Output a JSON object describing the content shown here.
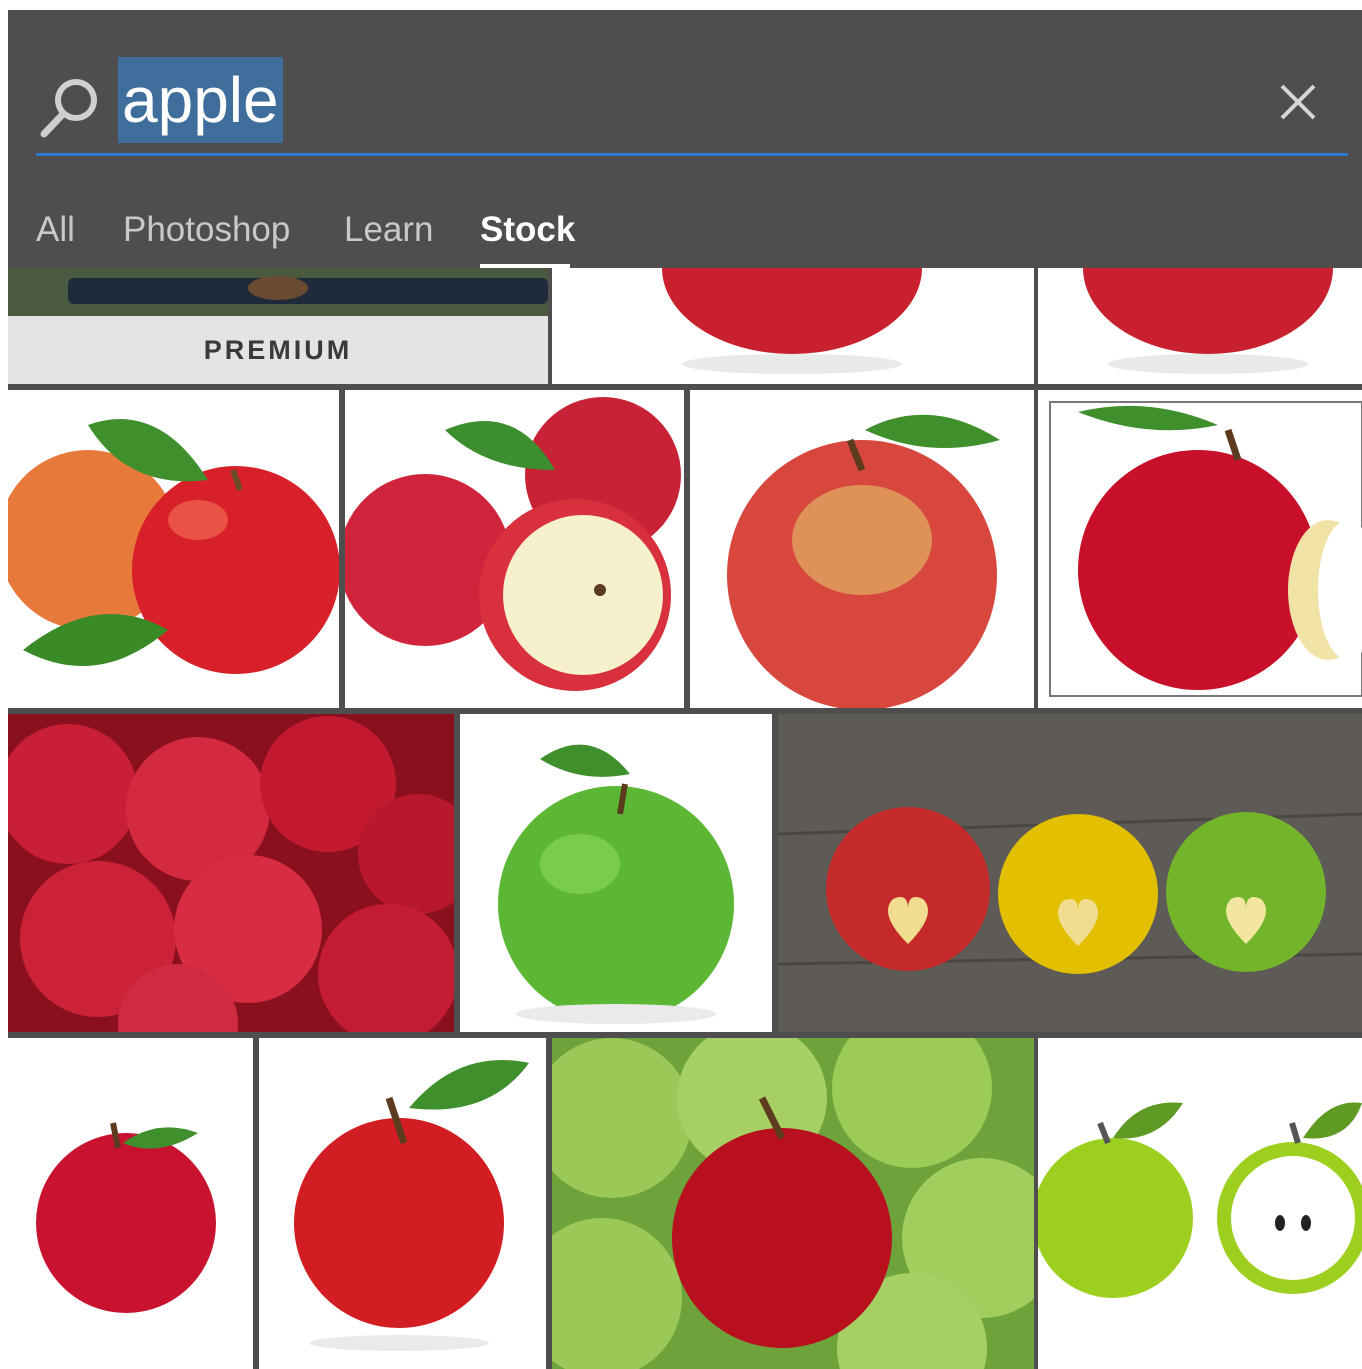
{
  "search": {
    "query": "apple",
    "clear_icon": "close-icon",
    "search_icon": "search-icon"
  },
  "tabs": [
    {
      "label": "All",
      "active": false
    },
    {
      "label": "Photoshop",
      "active": false
    },
    {
      "label": "Learn",
      "active": false
    },
    {
      "label": "Stock",
      "active": true
    }
  ],
  "results": {
    "premium_badge": "PREMIUM",
    "items": [
      {
        "subject": "premium-photo-partial"
      },
      {
        "subject": "red-apple-partial"
      },
      {
        "subject": "red-apple-partial"
      },
      {
        "subject": "two-red-apples-with-leaves"
      },
      {
        "subject": "red-apples-with-halved-apple"
      },
      {
        "subject": "red-green-apple-with-leaf"
      },
      {
        "subject": "bitten-red-apple"
      },
      {
        "subject": "pile-of-red-apples"
      },
      {
        "subject": "green-apple-with-leaf"
      },
      {
        "subject": "apples-with-heart-on-wood"
      },
      {
        "subject": "red-apple-with-leaf"
      },
      {
        "subject": "red-apple-with-green-leaf"
      },
      {
        "subject": "red-apple-among-green-apples"
      },
      {
        "subject": "green-apple-illustration"
      }
    ]
  },
  "colors": {
    "accent": "#2f7bd2",
    "panel": "#4e4e4e",
    "selection": "#3f6d9c"
  }
}
